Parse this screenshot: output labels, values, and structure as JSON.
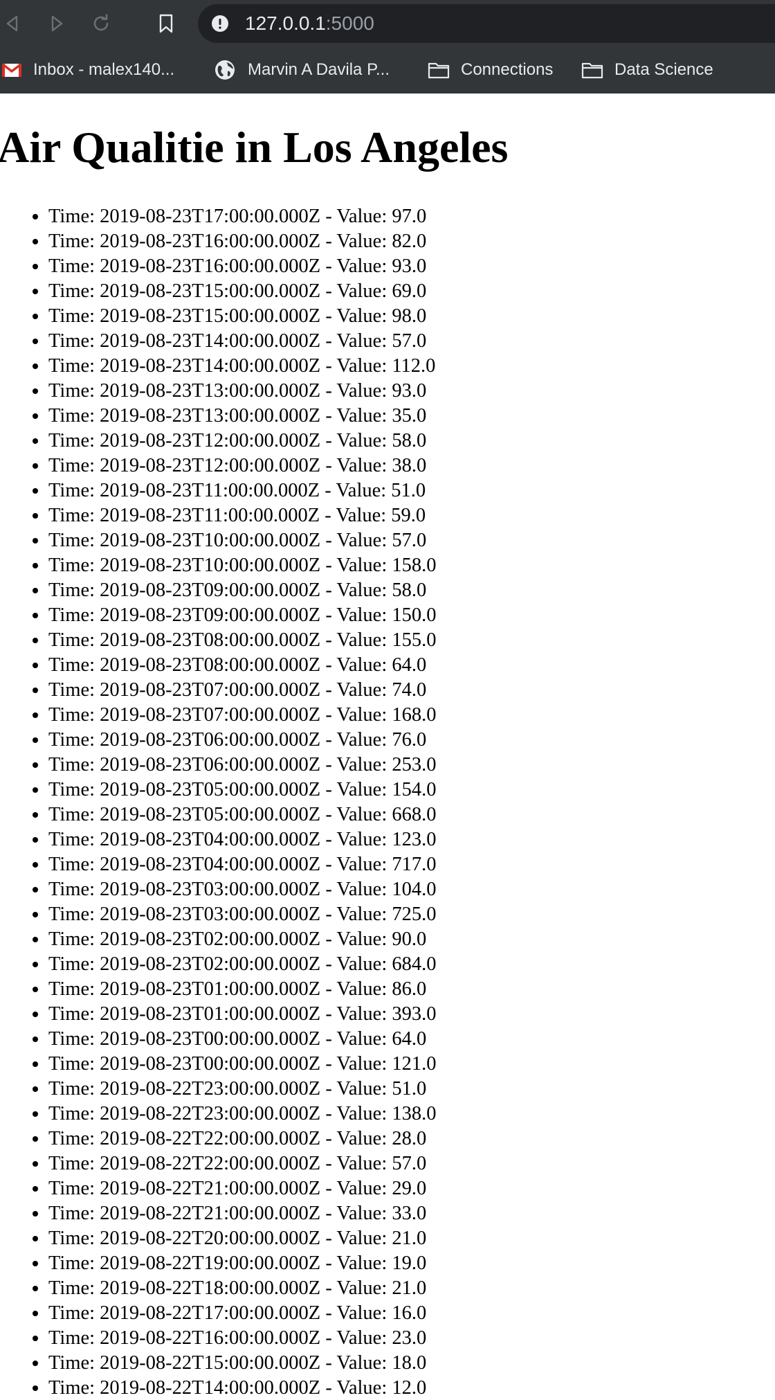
{
  "browser": {
    "url_host": "127.0.0.1",
    "url_port": ":5000",
    "icons": {
      "back": "back-arrow-icon",
      "forward": "forward-arrow-icon",
      "reload": "reload-icon",
      "bookmark": "bookmark-icon",
      "site_info": "info-icon"
    }
  },
  "bookmarks": [
    {
      "label": "Inbox  - malex140...",
      "icon": "gmail-icon"
    },
    {
      "label": "Marvin A Davila P...",
      "icon": "globe-icon"
    },
    {
      "label": "Connections",
      "icon": "folder-icon"
    },
    {
      "label": "Data Science",
      "icon": "folder-icon"
    }
  ],
  "page": {
    "title": "Air Qualitie in Los Angeles",
    "readings": [
      "Time: 2019-08-23T17:00:00.000Z - Value: 97.0",
      "Time: 2019-08-23T16:00:00.000Z - Value: 82.0",
      "Time: 2019-08-23T16:00:00.000Z - Value: 93.0",
      "Time: 2019-08-23T15:00:00.000Z - Value: 69.0",
      "Time: 2019-08-23T15:00:00.000Z - Value: 98.0",
      "Time: 2019-08-23T14:00:00.000Z - Value: 57.0",
      "Time: 2019-08-23T14:00:00.000Z - Value: 112.0",
      "Time: 2019-08-23T13:00:00.000Z - Value: 93.0",
      "Time: 2019-08-23T13:00:00.000Z - Value: 35.0",
      "Time: 2019-08-23T12:00:00.000Z - Value: 58.0",
      "Time: 2019-08-23T12:00:00.000Z - Value: 38.0",
      "Time: 2019-08-23T11:00:00.000Z - Value: 51.0",
      "Time: 2019-08-23T11:00:00.000Z - Value: 59.0",
      "Time: 2019-08-23T10:00:00.000Z - Value: 57.0",
      "Time: 2019-08-23T10:00:00.000Z - Value: 158.0",
      "Time: 2019-08-23T09:00:00.000Z - Value: 58.0",
      "Time: 2019-08-23T09:00:00.000Z - Value: 150.0",
      "Time: 2019-08-23T08:00:00.000Z - Value: 155.0",
      "Time: 2019-08-23T08:00:00.000Z - Value: 64.0",
      "Time: 2019-08-23T07:00:00.000Z - Value: 74.0",
      "Time: 2019-08-23T07:00:00.000Z - Value: 168.0",
      "Time: 2019-08-23T06:00:00.000Z - Value: 76.0",
      "Time: 2019-08-23T06:00:00.000Z - Value: 253.0",
      "Time: 2019-08-23T05:00:00.000Z - Value: 154.0",
      "Time: 2019-08-23T05:00:00.000Z - Value: 668.0",
      "Time: 2019-08-23T04:00:00.000Z - Value: 123.0",
      "Time: 2019-08-23T04:00:00.000Z - Value: 717.0",
      "Time: 2019-08-23T03:00:00.000Z - Value: 104.0",
      "Time: 2019-08-23T03:00:00.000Z - Value: 725.0",
      "Time: 2019-08-23T02:00:00.000Z - Value: 90.0",
      "Time: 2019-08-23T02:00:00.000Z - Value: 684.0",
      "Time: 2019-08-23T01:00:00.000Z - Value: 86.0",
      "Time: 2019-08-23T01:00:00.000Z - Value: 393.0",
      "Time: 2019-08-23T00:00:00.000Z - Value: 64.0",
      "Time: 2019-08-23T00:00:00.000Z - Value: 121.0",
      "Time: 2019-08-22T23:00:00.000Z - Value: 51.0",
      "Time: 2019-08-22T23:00:00.000Z - Value: 138.0",
      "Time: 2019-08-22T22:00:00.000Z - Value: 28.0",
      "Time: 2019-08-22T22:00:00.000Z - Value: 57.0",
      "Time: 2019-08-22T21:00:00.000Z - Value: 29.0",
      "Time: 2019-08-22T21:00:00.000Z - Value: 33.0",
      "Time: 2019-08-22T20:00:00.000Z - Value: 21.0",
      "Time: 2019-08-22T19:00:00.000Z - Value: 19.0",
      "Time: 2019-08-22T18:00:00.000Z - Value: 21.0",
      "Time: 2019-08-22T17:00:00.000Z - Value: 16.0",
      "Time: 2019-08-22T16:00:00.000Z - Value: 23.0",
      "Time: 2019-08-22T15:00:00.000Z - Value: 18.0",
      "Time: 2019-08-22T14:00:00.000Z - Value: 12.0"
    ]
  },
  "colors": {
    "chrome_bg": "#323639",
    "omnibox_bg": "#202124",
    "chrome_text": "#e8eaed",
    "muted_text": "#9aa0a6",
    "page_bg": "#ffffff",
    "page_text": "#000000"
  }
}
